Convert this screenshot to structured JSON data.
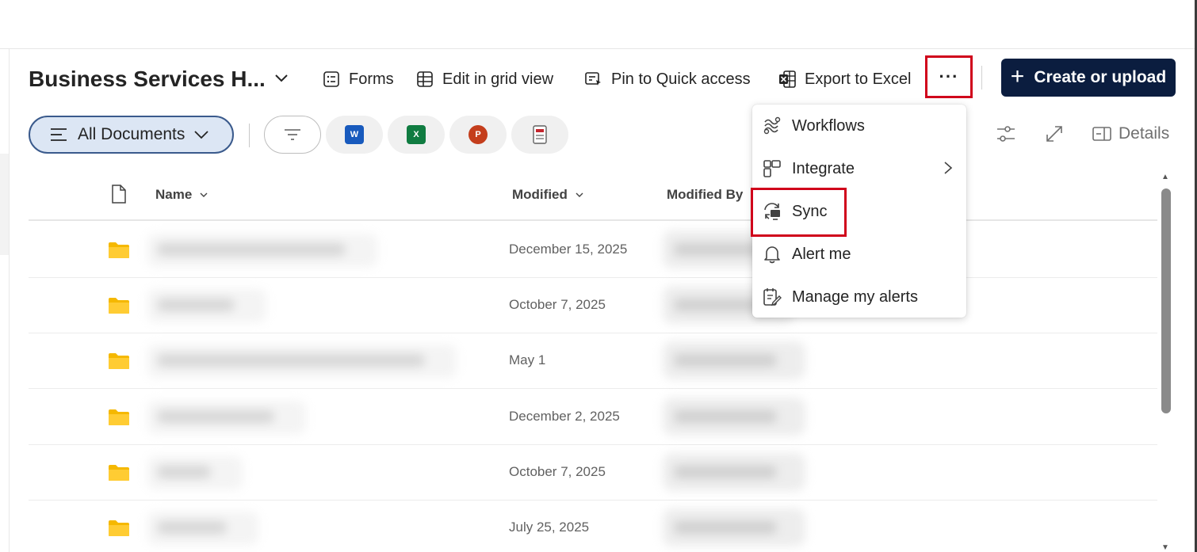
{
  "library": {
    "title": "Business Services H...",
    "chevron_icon": "chevron-down-icon"
  },
  "commands": {
    "forms": "Forms",
    "edit_grid": "Edit in grid view",
    "pin": "Pin to Quick access",
    "export": "Export to Excel",
    "more": "···",
    "create": "Create or upload"
  },
  "view": {
    "current": "All Documents",
    "details": "Details",
    "apps": [
      {
        "name": "Word",
        "letter": "W",
        "color": "#185abd"
      },
      {
        "name": "Excel",
        "letter": "X",
        "color": "#107c41"
      },
      {
        "name": "PowerPoint",
        "letter": "P",
        "color": "#c43e1c"
      }
    ]
  },
  "columns": {
    "name": "Name",
    "modified": "Modified",
    "modified_by": "Modified By"
  },
  "rows": [
    {
      "modified": "December 15, 2025"
    },
    {
      "modified": "October 7, 2025"
    },
    {
      "modified": "May 1"
    },
    {
      "modified": "December 2, 2025"
    },
    {
      "modified": "October 7, 2025"
    },
    {
      "modified": "July 25, 2025"
    }
  ],
  "menu": {
    "items": [
      {
        "label": "Workflows",
        "icon": "workflows-icon"
      },
      {
        "label": "Integrate",
        "icon": "integrate-icon",
        "submenu": true
      },
      {
        "label": "Sync",
        "icon": "sync-icon"
      },
      {
        "label": "Alert me",
        "icon": "bell-icon"
      },
      {
        "label": "Manage my alerts",
        "icon": "manage-alerts-icon"
      }
    ]
  },
  "colors": {
    "accent": "#0b1d3f",
    "highlight": "#d0021b",
    "pill_bg": "#dce6f4",
    "folder": "#f5b800"
  }
}
